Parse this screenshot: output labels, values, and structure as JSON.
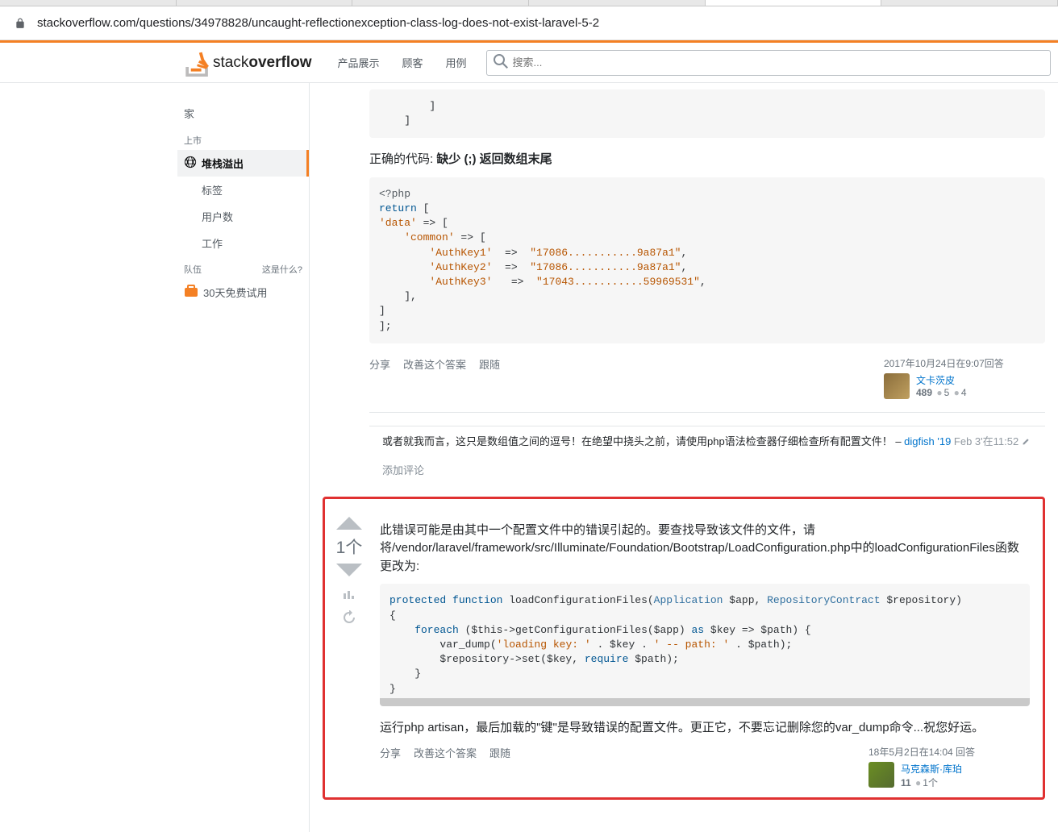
{
  "url": "stackoverflow.com/questions/34978828/uncaught-reflectionexception-class-log-does-not-exist-laravel-5-2",
  "logo": {
    "thin": "stack",
    "bold": "overflow"
  },
  "nav": {
    "a": "产品展示",
    "b": "顾客",
    "c": "用例"
  },
  "search": {
    "placeholder": "搜索..."
  },
  "sidebar": {
    "home": "家",
    "public": "上市",
    "stack": "堆栈溢出",
    "tags": "标签",
    "users": "用户数",
    "jobs": "工作",
    "teams": "队伍",
    "what": "这是什么?",
    "trial": "30天免费试用"
  },
  "code_top": "        ]\n    ]",
  "para_correct_pre": "正确的代码: ",
  "para_correct_bold": "缺少  (;)   返回数组末尾",
  "code_correct_l1": "<?php",
  "code_correct_l2a": "return",
  "code_correct_l2b": " [",
  "code_correct_l3a": "'data'",
  "code_correct_l3b": " => [",
  "code_correct_l4a": "    'common'",
  "code_correct_l4b": " => [",
  "code_correct_l5a": "        'AuthKey1'",
  "code_correct_l5b": "  =>  ",
  "code_correct_l5c": "\"17086...........9a87a1\"",
  "code_correct_l5d": ",",
  "code_correct_l6a": "        'AuthKey2'",
  "code_correct_l6c": "\"17086...........9a87a1\"",
  "code_correct_l7a": "        'AuthKey3'",
  "code_correct_l7b": "   =>  ",
  "code_correct_l7c": "\"17043...........59969531\"",
  "code_correct_l8": "    ],",
  "code_correct_l9": "]",
  "code_correct_l10": "];",
  "postmenu": {
    "share": "分享",
    "edit": "改善这个答案",
    "follow": "跟随"
  },
  "user1": {
    "when": "2017年10月24日在9:07回答",
    "name": "文卡茨皮",
    "rep": "489",
    "b1": "5",
    "b2": "4"
  },
  "comment1": {
    "text": "或者就我而言，这只是数组值之间的逗号！在绝望中挠头之前，请使用php语法检查器仔细检查所有配置文件！",
    "dash": " –  ",
    "author": "digfish '19",
    "date2": " Feb 3'在11:52"
  },
  "addcomment": "添加评论",
  "answer2": {
    "count": "1个",
    "para1": "此错误可能是由其中一个配置文件中的错误引起的。要查找导致该文件的文件，请将/vendor/laravel/framework/src/Illuminate/Foundation/Bootstrap/LoadConfiguration.php中的loadConfigurationFiles函数更改为:",
    "para2": "运行php artisan，最后加载的\"键\"是导致错误的配置文件。更正它，不要忘记删除您的var_dump命令...祝您好运。"
  },
  "code2_l1a": "protected",
  "code2_l1b": " function",
  "code2_l1c": " loadConfigurationFiles(",
  "code2_l1d": "Application",
  "code2_l1e": " $app, ",
  "code2_l1f": "RepositoryContract",
  "code2_l1g": " $repository)",
  "code2_l2": "{",
  "code2_l3a": "    foreach",
  "code2_l3b": " ($this->getConfigurationFiles($app) ",
  "code2_l3c": "as",
  "code2_l3d": " $key => $path) {",
  "code2_l4a": "        var_dump(",
  "code2_l4b": "'loading key: '",
  "code2_l4c": " . $key . ",
  "code2_l4d": "' -- path: '",
  "code2_l4e": " . $path);",
  "code2_l5a": "        $repository->set($key, ",
  "code2_l5b": "require",
  "code2_l5c": " $path);",
  "code2_l6": "    }",
  "code2_l7": "}",
  "user2": {
    "when": "18年5月2日在14:04 回答",
    "name": "马克森斯·库珀",
    "rep": "11",
    "b1": "1个"
  }
}
